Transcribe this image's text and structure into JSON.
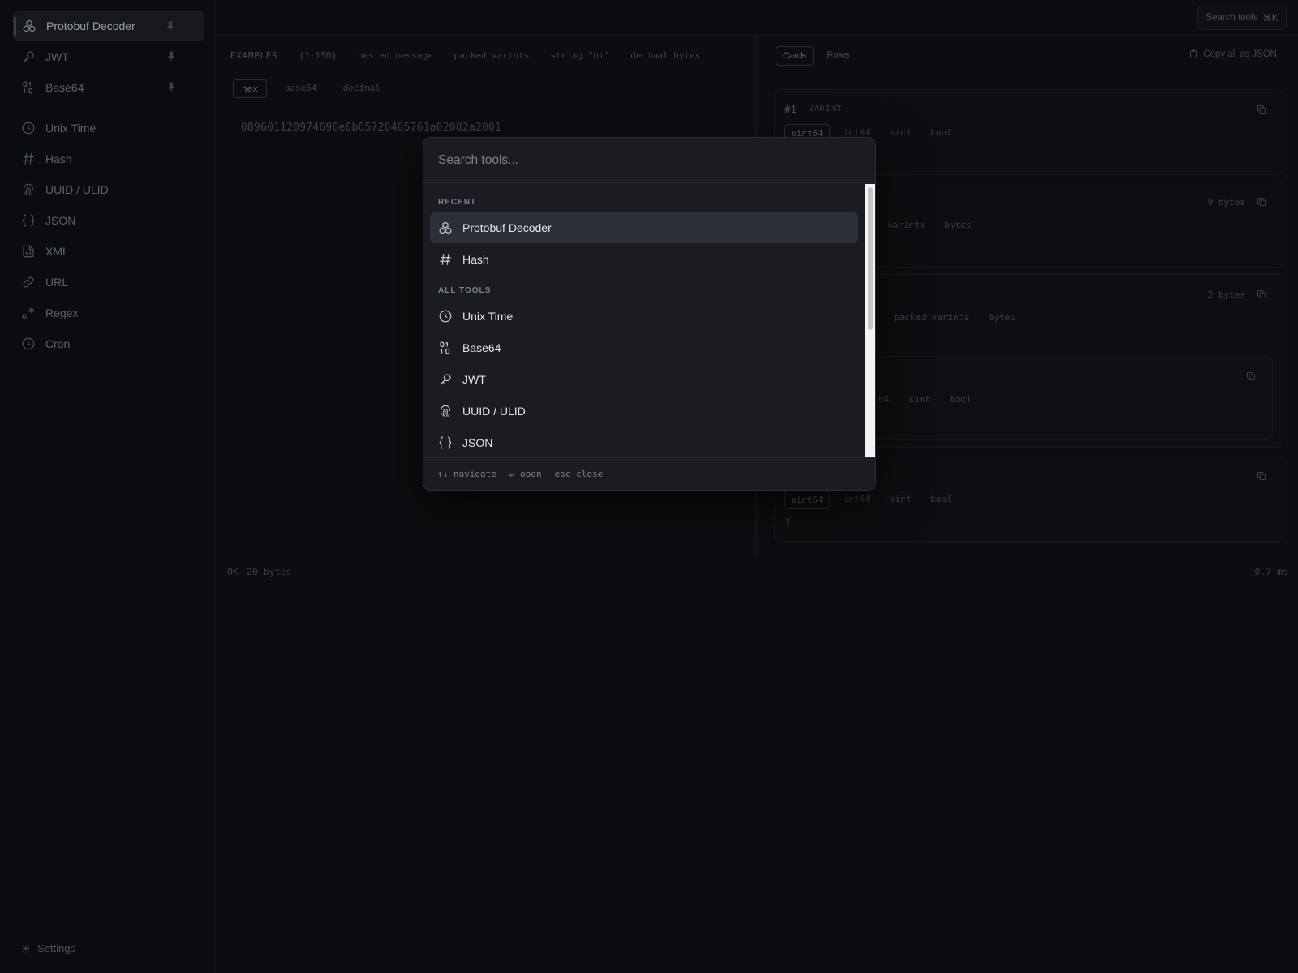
{
  "sidebar": {
    "pinned": [
      {
        "label": "Protobuf Decoder",
        "icon": "cubes-icon"
      },
      {
        "label": "JWT",
        "icon": "key-icon"
      },
      {
        "label": "Base64",
        "icon": "binary-icon"
      }
    ],
    "tools": [
      {
        "label": "Unix Time",
        "icon": "clock-icon"
      },
      {
        "label": "Hash",
        "icon": "hash-icon"
      },
      {
        "label": "UUID / ULID",
        "icon": "fingerprint-icon"
      },
      {
        "label": "JSON",
        "icon": "braces-icon"
      },
      {
        "label": "XML",
        "icon": "file-code-icon"
      },
      {
        "label": "URL",
        "icon": "link-icon"
      },
      {
        "label": "Regex",
        "icon": "regex-icon"
      },
      {
        "label": "Cron",
        "icon": "clock-icon"
      }
    ],
    "settings_label": "Settings"
  },
  "topbar": {
    "search_label": "Search tools",
    "search_shortcut": "⌘K"
  },
  "left": {
    "examples_label": "EXAMPLES",
    "examples": [
      "{1:150}",
      "nested message",
      "packed varints",
      "string \"hi\"",
      "decimal bytes"
    ],
    "formats": [
      "hex",
      "base64",
      "decimal"
    ],
    "active_format": "hex",
    "hex_value": "089601120974696e6b65726465761a02082a2001"
  },
  "right": {
    "view_tabs": [
      "Cards",
      "Rows"
    ],
    "active_view": "Cards",
    "copy_all_label": "Copy all as JSON",
    "cards": [
      {
        "index": "#1",
        "wire": "VARINT",
        "bytes": "",
        "chips": [
          "uint64",
          "int64",
          "sint",
          "bool"
        ],
        "value": ""
      },
      {
        "index": "",
        "wire": "",
        "bytes": "9 bytes",
        "chips": [
          "varints",
          "bytes"
        ],
        "value": ""
      },
      {
        "index": "",
        "wire": "",
        "bytes": "2 bytes",
        "chips": [
          "packed varints",
          "bytes"
        ],
        "value": ""
      },
      {
        "index": "",
        "wire": "",
        "bytes": "",
        "chips": [
          "64",
          "sint",
          "bool"
        ],
        "value": ""
      },
      {
        "index": "",
        "wire": "",
        "bytes": "",
        "chips": [
          "uint64",
          "int64",
          "sint",
          "bool"
        ],
        "value": "1"
      }
    ]
  },
  "status": {
    "ok": "OK",
    "size": "20 bytes",
    "time": "0.7 ms"
  },
  "palette": {
    "placeholder": "Search tools...",
    "recent_label": "RECENT",
    "recent": [
      {
        "label": "Protobuf Decoder",
        "icon": "cubes-icon"
      },
      {
        "label": "Hash",
        "icon": "hash-icon"
      }
    ],
    "all_label": "ALL TOOLS",
    "all": [
      {
        "label": "Unix Time",
        "icon": "clock-icon"
      },
      {
        "label": "Base64",
        "icon": "binary-icon"
      },
      {
        "label": "JWT",
        "icon": "key-icon"
      },
      {
        "label": "UUID / ULID",
        "icon": "fingerprint-icon"
      },
      {
        "label": "JSON",
        "icon": "braces-icon"
      }
    ],
    "footer": {
      "navigate_key": "↑↓",
      "navigate": "navigate",
      "open_key": "↵",
      "open": "open",
      "close_key": "esc",
      "close": "close"
    }
  }
}
